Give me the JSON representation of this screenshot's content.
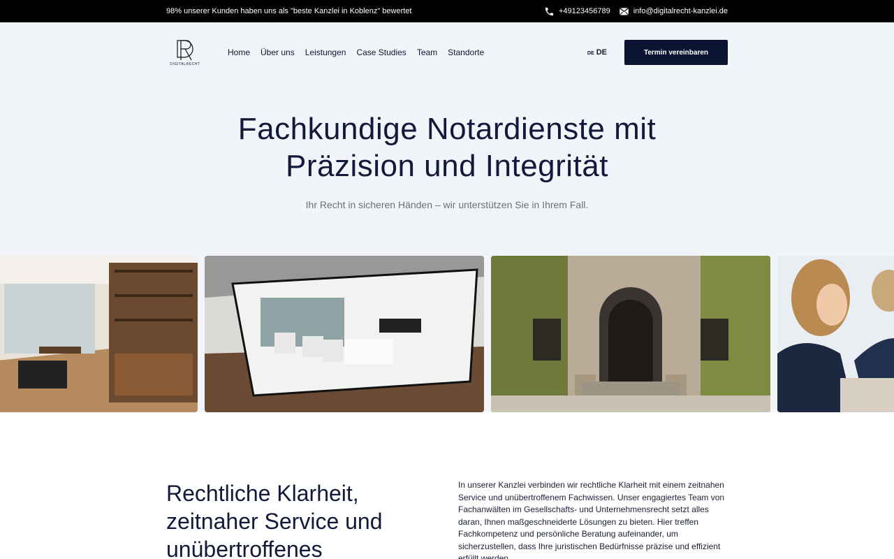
{
  "topbar": {
    "rating_text": "98% unserer Kunden haben uns als \"beste Kanzlei in Koblenz\" bewertet",
    "phone": "+49123456789",
    "email": "info@digitalrecht-kanzlei.de"
  },
  "logo": {
    "letters": "DR",
    "wordmark": "DIGITALRECHT"
  },
  "nav": {
    "items": [
      "Home",
      "Über uns",
      "Leistungen",
      "Case Studies",
      "Team",
      "Standorte"
    ],
    "language_flag": "DE",
    "language": "DE",
    "cta": "Termin vereinbaren"
  },
  "hero": {
    "title_line1": "Fachkundige Notardienste mit",
    "title_line2": "Präzision und Integrität",
    "subtitle": "Ihr Recht in sicheren Händen – wir unterstützen Sie in Ihrem Fall."
  },
  "gallery": {
    "images": [
      "office-interior-photo",
      "glass-meeting-room-photo",
      "historic-building-entrance-photo",
      "business-meeting-photo"
    ]
  },
  "intro": {
    "heading_line1": "Rechtliche Klarheit,",
    "heading_line2": "zeitnaher Service und",
    "heading_line3": "unübertroffenes",
    "body": "In unserer Kanzlei verbinden wir rechtliche Klarheit mit einem zeitnahen Service und unübertroffenem Fachwissen. Unser engagiertes Team von Fachanwälten im Gesellschafts- und Unternehmensrecht setzt alles daran, Ihnen maßgeschneiderte Lösungen zu bieten. Hier treffen Fachkompetenz und persönliche Beratung aufeinander, um sicherzustellen, dass Ihre juristischen Bedürfnisse präzise und effizient erfüllt werden."
  },
  "colors": {
    "topbar": "#000000",
    "hero_bg": "#f1f4f8",
    "accent": "#0c1433"
  }
}
